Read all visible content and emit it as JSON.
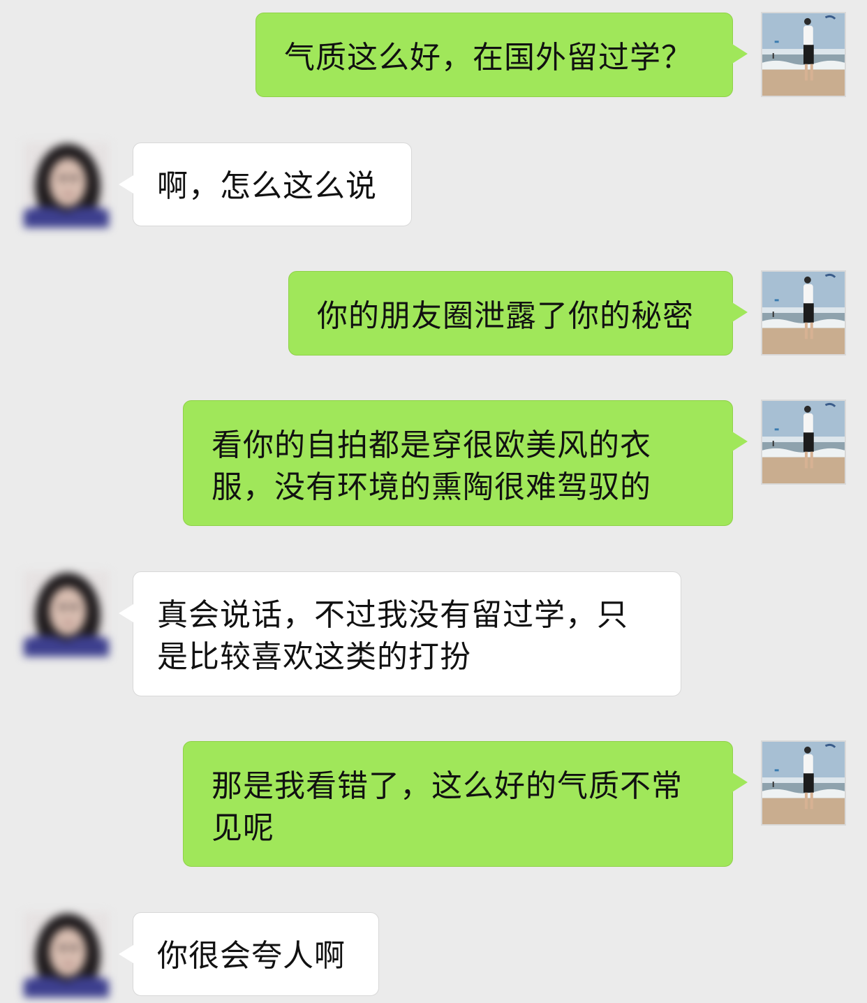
{
  "chat": {
    "messages": [
      {
        "sender": "me",
        "text": "气质这么好，在国外留过学？"
      },
      {
        "sender": "her",
        "text": "啊，怎么这么说"
      },
      {
        "sender": "me",
        "text": "你的朋友圈泄露了你的秘密"
      },
      {
        "sender": "me",
        "text": "看你的自拍都是穿很欧美风的衣服，没有环境的熏陶很难驾驭的"
      },
      {
        "sender": "her",
        "text": "真会说话，不过我没有留过学，只是比较喜欢这类的打扮"
      },
      {
        "sender": "me",
        "text": "那是我看错了，这么好的气质不常见呢"
      },
      {
        "sender": "her",
        "text": "你很会夸人啊"
      }
    ]
  },
  "colors": {
    "background": "#ebebeb",
    "sent_bubble": "#a0e75a",
    "received_bubble": "#ffffff",
    "text": "#111111"
  },
  "icons": {
    "me_avatar": "beach-photo-avatar",
    "her_avatar": "blurred-portrait-avatar"
  }
}
